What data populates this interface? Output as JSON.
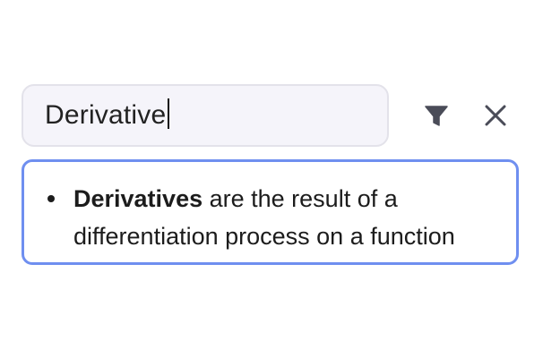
{
  "search": {
    "value": "Derivative"
  },
  "toolbar": {
    "filter_icon": "filter-icon",
    "close_icon": "close-icon"
  },
  "result": {
    "term": "Derivatives",
    "definition": " are the result of a differentiation process on a function"
  },
  "colors": {
    "accent_border": "#6f8ff0",
    "search_bg": "#f5f4fa",
    "icon": "#4a4c58"
  }
}
